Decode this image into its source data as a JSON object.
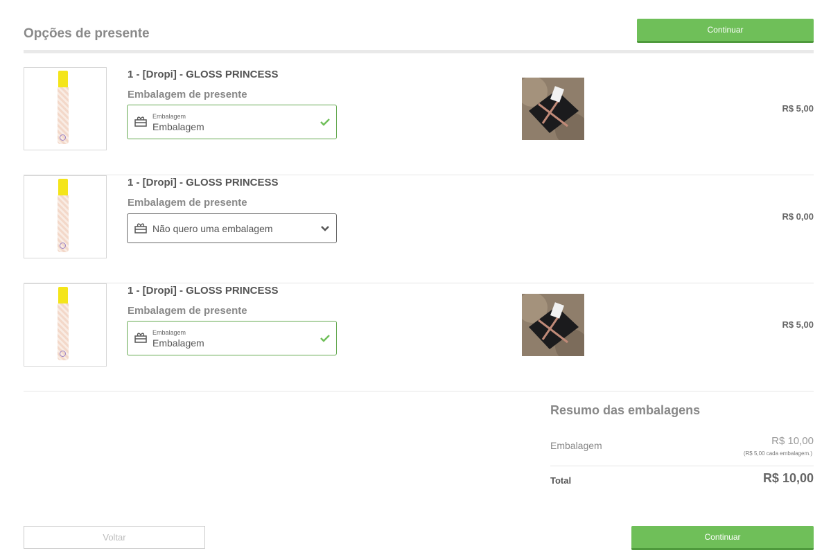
{
  "page": {
    "title": "Opções de presente"
  },
  "actions": {
    "continue_label": "Continuar",
    "back_label": "Voltar"
  },
  "colors": {
    "accent_green": "#6fbf59",
    "field_border_valid": "#63a84e"
  },
  "items": [
    {
      "name": "1 - [Dropi] - GLOSS PRINCESS",
      "wrap_label": "Embalagem de presente",
      "field_small_label": "Embalagem",
      "field_value": "Embalagem",
      "state": "selected",
      "price": "R$ 5,00",
      "icon": "gift-icon"
    },
    {
      "name": "1 - [Dropi] - GLOSS PRINCESS",
      "wrap_label": "Embalagem de presente",
      "field_value": "Não quero uma embalagem",
      "state": "not-selected",
      "price": "R$ 0,00",
      "icon": "gift-icon"
    },
    {
      "name": "1 - [Dropi] - GLOSS PRINCESS",
      "wrap_label": "Embalagem de presente",
      "field_small_label": "Embalagem",
      "field_value": "Embalagem",
      "state": "selected",
      "price": "R$ 5,00",
      "icon": "gift-icon"
    }
  ],
  "summary": {
    "title": "Resumo das embalagens",
    "line_label": "Embalagem",
    "line_value": "R$ 10,00",
    "line_note": "(R$ 5,00 cada embalagem.)",
    "total_label": "Total",
    "total_value": "R$ 10,00"
  }
}
